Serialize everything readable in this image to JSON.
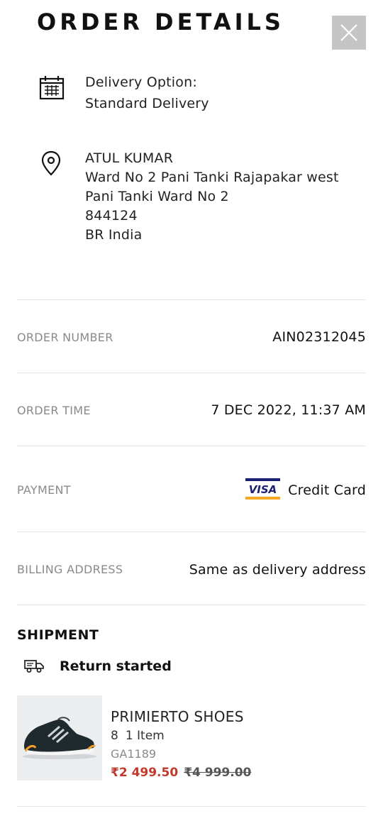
{
  "header": {
    "title": "ORDER DETAILS"
  },
  "delivery": {
    "icon": "calendar-icon",
    "label": "Delivery Option:",
    "value": "Standard Delivery"
  },
  "address": {
    "icon": "location-pin-icon",
    "name": "ATUL KUMAR",
    "line1": "Ward No 2 Pani Tanki Rajapakar west",
    "line2": "Pani Tanki Ward No 2",
    "postcode": "844124",
    "region": "BR India"
  },
  "order": {
    "number_label": "ORDER NUMBER",
    "number_value": "AIN02312045",
    "time_label": "ORDER TIME",
    "time_value": "7 DEC 2022, 11:37 AM",
    "payment_label": "PAYMENT",
    "payment_brand": "VISA",
    "payment_value": "Credit Card",
    "billing_label": "BILLING ADDRESS",
    "billing_value": "Same as delivery address"
  },
  "shipment": {
    "title": "SHIPMENT",
    "status_icon": "delivery-truck-icon",
    "status": "Return started",
    "product": {
      "name": "PRIMIERTO SHOES",
      "size": "8",
      "quantity": "1 Item",
      "sku": "GA1189",
      "price": "₹2 499.50",
      "original_price": "₹4 999.00"
    }
  },
  "colors": {
    "sale_price": "#c0392b",
    "visa_blue": "#1a1f71",
    "visa_gold": "#f7a823",
    "close_bg": "#c5c5c5"
  }
}
